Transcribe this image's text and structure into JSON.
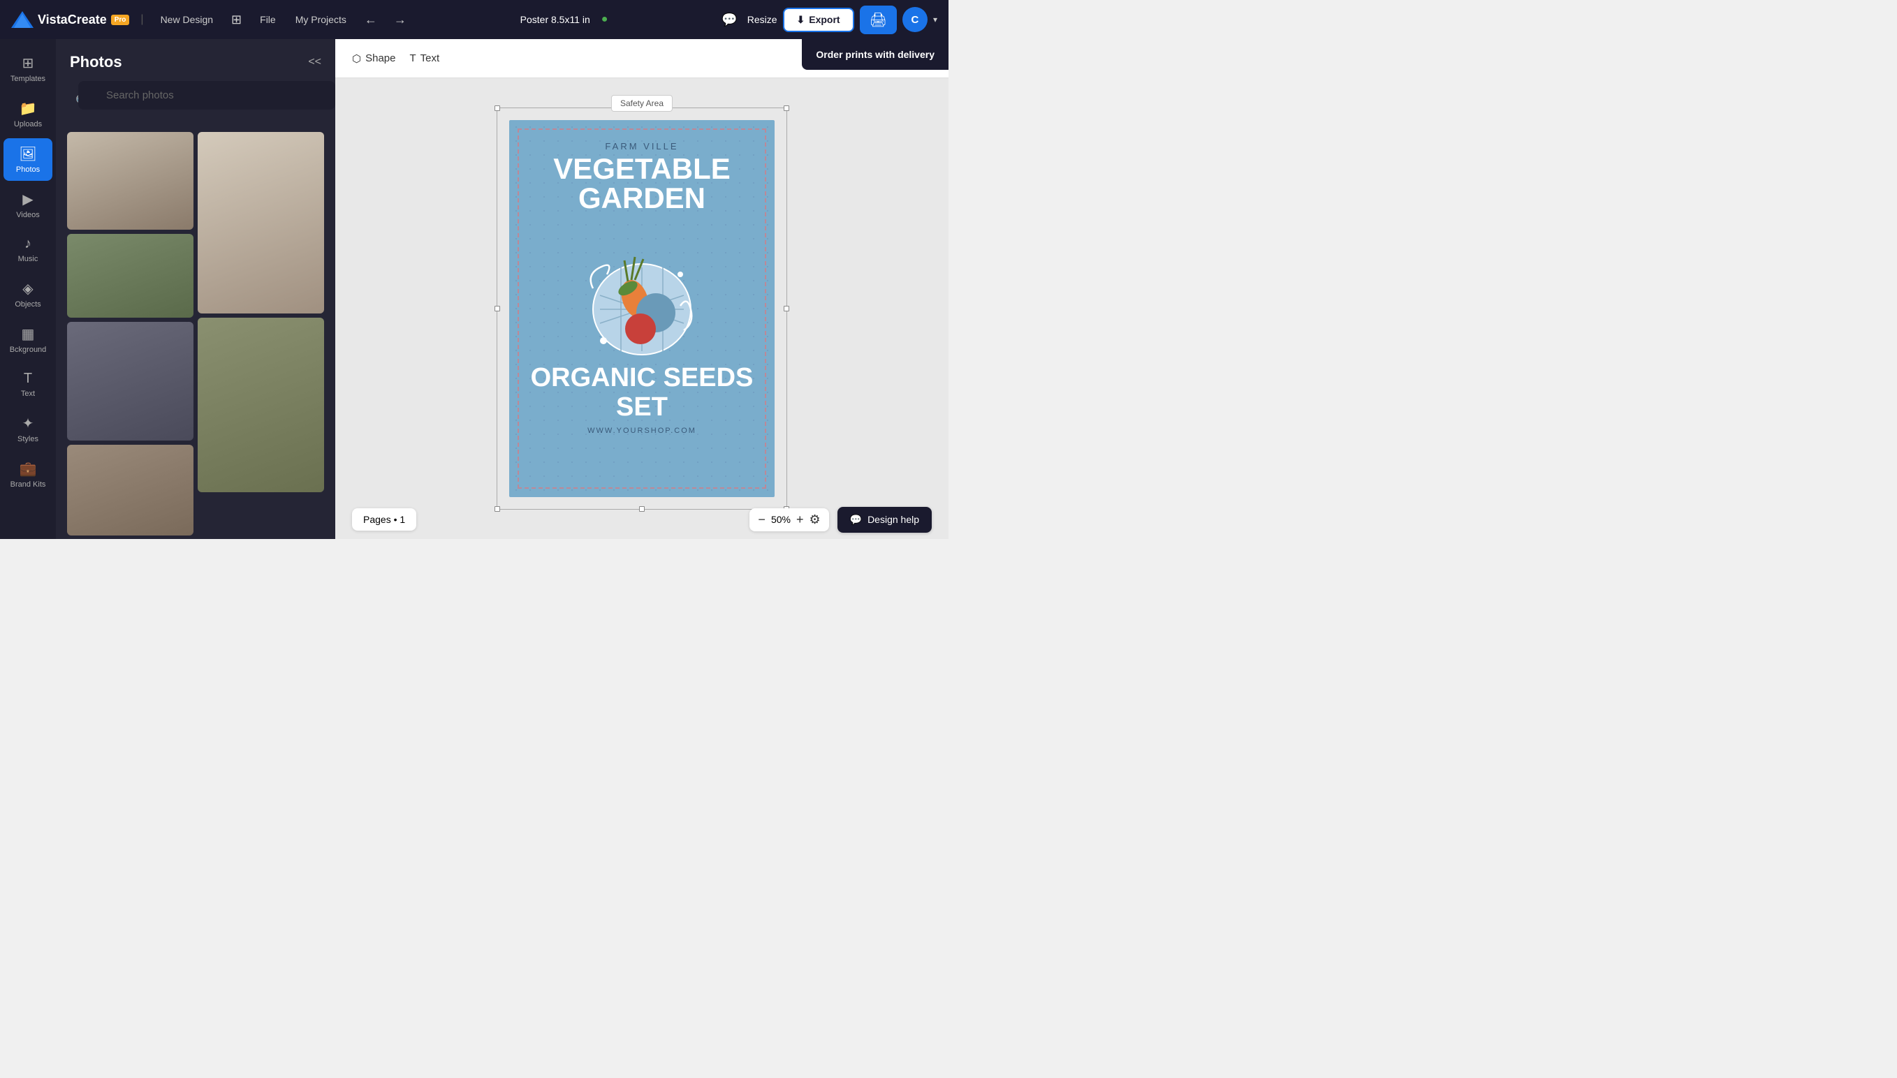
{
  "app": {
    "logo": "VistaCreate",
    "pro_label": "Pro",
    "new_design": "New Design",
    "file": "File",
    "my_projects": "My Projects"
  },
  "header": {
    "project_title": "Poster 8.5x11 in",
    "resize_label": "Resize",
    "export_label": "Export",
    "avatar_letter": "C"
  },
  "tooltip": {
    "order_prints": "Order prints with delivery"
  },
  "sidebar": {
    "items": [
      {
        "id": "templates",
        "label": "Templates",
        "icon": "⊞"
      },
      {
        "id": "uploads",
        "label": "Uploads",
        "icon": "📁"
      },
      {
        "id": "photos",
        "label": "Photos",
        "icon": "🖼"
      },
      {
        "id": "videos",
        "label": "Videos",
        "icon": "▶"
      },
      {
        "id": "music",
        "label": "Music",
        "icon": "♪"
      },
      {
        "id": "objects",
        "label": "Objects",
        "icon": "◈"
      },
      {
        "id": "background",
        "label": "Bckground",
        "icon": "▦"
      },
      {
        "id": "text",
        "label": "Text",
        "icon": "T"
      },
      {
        "id": "styles",
        "label": "Styles",
        "icon": "✦"
      },
      {
        "id": "brand-kits",
        "label": "Brand Kits",
        "icon": "💼"
      }
    ],
    "active": "photos"
  },
  "photos_panel": {
    "title": "Photos",
    "search_placeholder": "Search photos",
    "collapse_icon": "<<"
  },
  "canvas_toolbar": {
    "shape_label": "Shape",
    "text_label": "Text"
  },
  "poster": {
    "safety_area": "Safety Area",
    "farm_ville": "FARM VILLE",
    "vegetable_garden": "VEGETABLE GARDEN",
    "organic_seeds": "ORGANIC SEEDS SET",
    "website": "WWW.YOURSHOP.COM"
  },
  "bottom_bar": {
    "pages_label": "Pages • 1",
    "zoom_level": "50%",
    "design_help": "Design help"
  }
}
